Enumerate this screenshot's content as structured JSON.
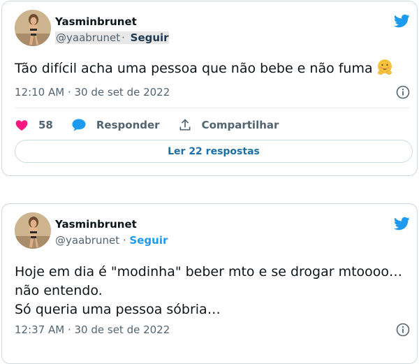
{
  "tweets": [
    {
      "author_name": "Yasminbrunet",
      "handle": "@yaabrunet",
      "separator": "·",
      "follow_label": "Seguir",
      "text": "Tão difícil acha uma pessoa que não bebe e não fuma",
      "emoji": "blushing-smiley",
      "timestamp": "12:10 AM · 30 de set de 2022",
      "likes": "58",
      "reply_label": "Responder",
      "share_label": "Compartilhar",
      "read_replies_label": "Ler 22 respostas"
    },
    {
      "author_name": "Yasminbrunet",
      "handle": "@yaabrunet",
      "separator": "·",
      "follow_label": "Seguir",
      "text_lines": [
        "Hoje em dia é \"modinha\" beber mto e se drogar mtoooo…",
        "não entendo.",
        "Só queria uma pessoa sóbria…"
      ],
      "timestamp": "12:37 AM · 30 de set de 2022"
    }
  ],
  "icons": {
    "brand": "twitter-bird-icon",
    "info": "info-icon",
    "like": "heart-icon",
    "reply": "speech-bubble-icon",
    "share": "share-upload-icon"
  },
  "colors": {
    "twitter_blue": "#1d9bf0",
    "like_pink": "#f91880",
    "text_primary": "#0f1419",
    "text_secondary": "#536471",
    "border": "#cfd9de"
  }
}
